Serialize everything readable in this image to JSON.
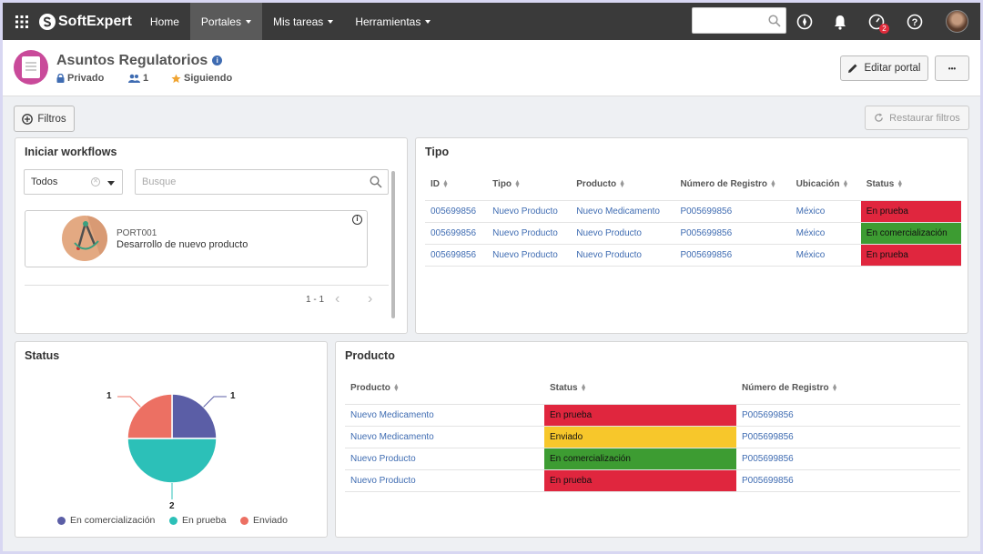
{
  "topbar": {
    "brand": "SoftExpert",
    "nav": [
      {
        "label": "Home",
        "caret": false,
        "active": false
      },
      {
        "label": "Portales",
        "caret": true,
        "active": true
      },
      {
        "label": "Mis tareas",
        "caret": true,
        "active": false
      },
      {
        "label": "Herramientas",
        "caret": true,
        "active": false
      }
    ],
    "notification_badge": "2"
  },
  "header": {
    "title": "Asuntos Regulatorios",
    "privacy": "Privado",
    "members": "1",
    "following": "Siguiendo",
    "edit_button": "Editar portal",
    "more_button": "•••"
  },
  "toolbar": {
    "filters_button": "Filtros",
    "reset_filters_button": "Restaurar filtros"
  },
  "workflows": {
    "title": "Iniciar workflows",
    "select_value": "Todos",
    "search_placeholder": "Busque",
    "items": [
      {
        "code": "PORT001",
        "name": "Desarrollo de nuevo producto"
      }
    ],
    "pagination": "1 - 1"
  },
  "tipo": {
    "title": "Tipo",
    "columns": [
      "ID",
      "Tipo",
      "Producto",
      "Número de Registro",
      "Ubicación",
      "Status"
    ],
    "rows": [
      {
        "id": "005699856",
        "tipo": "Nuevo Producto",
        "producto": "Nuevo Medicamento",
        "registro": "P005699856",
        "ubicacion": "México",
        "status": "En prueba",
        "status_color": "#e0263e"
      },
      {
        "id": "005699856",
        "tipo": "Nuevo Producto",
        "producto": "Nuevo Producto",
        "registro": "P005699856",
        "ubicacion": "México",
        "status": "En comercialización",
        "status_color": "#3d9c32"
      },
      {
        "id": "005699856",
        "tipo": "Nuevo Producto",
        "producto": "Nuevo Producto",
        "registro": "P005699856",
        "ubicacion": "México",
        "status": "En prueba",
        "status_color": "#e0263e"
      }
    ]
  },
  "status_panel": {
    "title": "Status"
  },
  "producto": {
    "title": "Producto",
    "columns": [
      "Producto",
      "Status",
      "Número de Registro"
    ],
    "rows": [
      {
        "producto": "Nuevo Medicamento",
        "status": "En prueba",
        "status_color": "#e0263e",
        "registro": "P005699856"
      },
      {
        "producto": "Nuevo Medicamento",
        "status": "Enviado",
        "status_color": "#f7c72b",
        "registro": "P005699856"
      },
      {
        "producto": "Nuevo Producto",
        "status": "En comercialización",
        "status_color": "#3d9c32",
        "registro": "P005699856"
      },
      {
        "producto": "Nuevo Producto",
        "status": "En prueba",
        "status_color": "#e0263e",
        "registro": "P005699856"
      }
    ]
  },
  "chart_data": {
    "type": "pie",
    "title": "",
    "series": [
      {
        "name": "En comercialización",
        "value": 1,
        "color": "#5b5ea6"
      },
      {
        "name": "En prueba",
        "value": 2,
        "color": "#2cc0b8"
      },
      {
        "name": "Enviado",
        "value": 1,
        "color": "#ec7063"
      }
    ],
    "legend": "bottom"
  }
}
